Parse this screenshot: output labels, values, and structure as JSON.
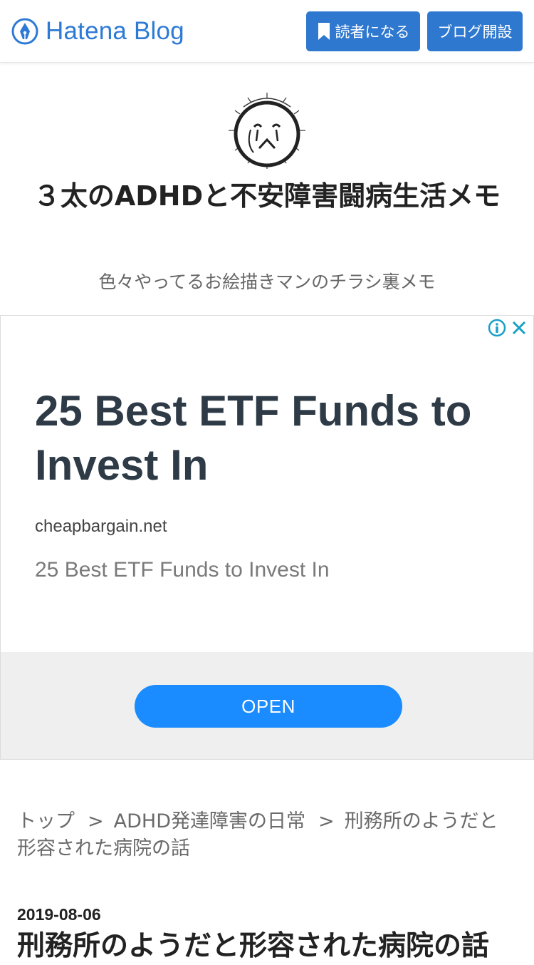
{
  "header": {
    "logo_text": "Hatena Blog",
    "reader_button_label": "読者になる",
    "open_blog_button_label": "ブログ開設"
  },
  "blog": {
    "title": "３太のADHDと不安障害闘病生活メモ",
    "description": "色々やってるお絵描きマンのチラシ裏メモ",
    "avatar_icon": "hand-drawn-face-avatar"
  },
  "ad": {
    "headline": "25 Best ETF Funds to Invest In",
    "domain": "cheapbargain.net",
    "description": "25 Best ETF Funds to Invest In",
    "cta_label": "OPEN",
    "info_icon": "info-icon",
    "close_icon": "close-icon"
  },
  "breadcrumb": {
    "items": [
      "トップ",
      "ADHD発達障害の日常",
      "刑務所のようだと形容された病院の話"
    ],
    "separator": ">"
  },
  "article": {
    "date": "2019-08-06",
    "title": "刑務所のようだと形容された病院の話"
  },
  "colors": {
    "brand_blue": "#2f78cf",
    "ad_cta_blue": "#1a8cff",
    "ad_headline": "#2e3b47"
  }
}
